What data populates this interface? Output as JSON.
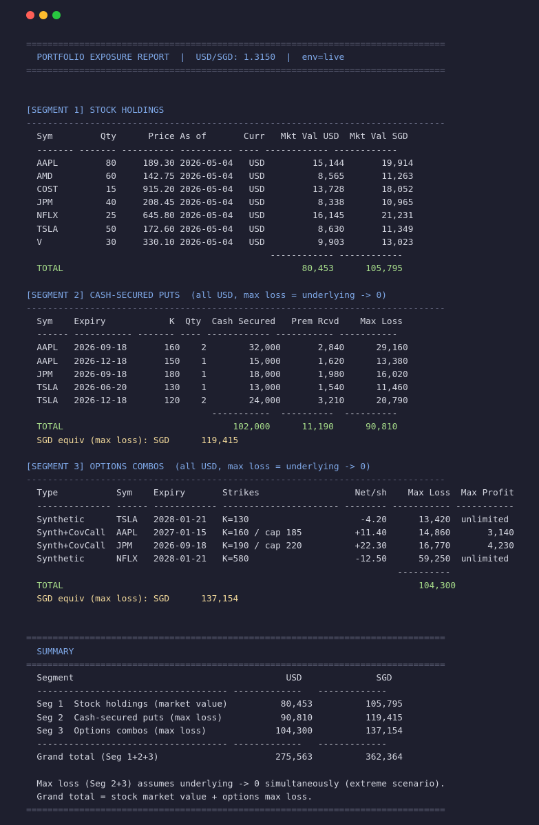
{
  "window": {
    "buttons": [
      "close",
      "minimize",
      "maximize"
    ]
  },
  "colors": {
    "background": "#1e1f2e",
    "text": "#d2d4de",
    "heading": "#7ea7e6",
    "total": "#a6db8a",
    "sgd_equiv": "#f1d89a",
    "rule": "#5d6077"
  },
  "lines": [
    {
      "kind": "rule",
      "text": "==============================================================================="
    },
    {
      "kind": "heading",
      "text": "  PORTFOLIO EXPOSURE REPORT  |  USD/SGD: 1.3150  |  env=live"
    },
    {
      "kind": "rule",
      "text": "==============================================================================="
    },
    {
      "kind": "blank",
      "text": ""
    },
    {
      "kind": "blank",
      "text": ""
    },
    {
      "kind": "heading",
      "text": "[SEGMENT 1] STOCK HOLDINGS"
    },
    {
      "kind": "rule",
      "text": "-------------------------------------------------------------------------------"
    },
    {
      "kind": "text",
      "text": "  Sym         Qty      Price As of       Curr   Mkt Val USD  Mkt Val SGD"
    },
    {
      "kind": "text",
      "text": "  ------- ------- ---------- ---------- ---- ------------ ------------"
    },
    {
      "kind": "text",
      "text": "  AAPL         80     189.30 2026-05-04   USD         15,144       19,914"
    },
    {
      "kind": "text",
      "text": "  AMD          60     142.75 2026-05-04   USD          8,565       11,263"
    },
    {
      "kind": "text",
      "text": "  COST         15     915.20 2026-05-04   USD         13,728       18,052"
    },
    {
      "kind": "text",
      "text": "  JPM          40     208.45 2026-05-04   USD          8,338       10,965"
    },
    {
      "kind": "text",
      "text": "  NFLX         25     645.80 2026-05-04   USD         16,145       21,231"
    },
    {
      "kind": "text",
      "text": "  TSLA         50     172.60 2026-05-04   USD          8,630       11,349"
    },
    {
      "kind": "text",
      "text": "  V            30     330.10 2026-05-04   USD          9,903       13,023"
    },
    {
      "kind": "text",
      "text": "                                              ------------ ------------"
    },
    {
      "kind": "total",
      "text": "  TOTAL                                             80,453      105,795"
    },
    {
      "kind": "blank",
      "text": ""
    },
    {
      "kind": "heading",
      "text": "[SEGMENT 2] CASH-SECURED PUTS  (all USD, max loss = underlying -> 0)"
    },
    {
      "kind": "rule",
      "text": "-------------------------------------------------------------------------------"
    },
    {
      "kind": "text",
      "text": "  Sym    Expiry            K  Qty  Cash Secured   Prem Rcvd    Max Loss"
    },
    {
      "kind": "text",
      "text": "  ------ ----------- ------- ---- ------------ ----------- -----------"
    },
    {
      "kind": "text",
      "text": "  AAPL   2026-09-18       160    2        32,000       2,840      29,160"
    },
    {
      "kind": "text",
      "text": "  AAPL   2026-12-18       150    1        15,000       1,620      13,380"
    },
    {
      "kind": "text",
      "text": "  JPM    2026-09-18       180    1        18,000       1,980      16,020"
    },
    {
      "kind": "text",
      "text": "  TSLA   2026-06-20       130    1        13,000       1,540      11,460"
    },
    {
      "kind": "text",
      "text": "  TSLA   2026-12-18       120    2        24,000       3,210      20,790"
    },
    {
      "kind": "text",
      "text": "                                   -----------  ----------  ----------"
    },
    {
      "kind": "total",
      "text": "  TOTAL                                102,000      11,190      90,810"
    },
    {
      "kind": "sgd",
      "text": "  SGD equiv (max loss): SGD      119,415"
    },
    {
      "kind": "blank",
      "text": ""
    },
    {
      "kind": "heading",
      "text": "[SEGMENT 3] OPTIONS COMBOS  (all USD, max loss = underlying -> 0)"
    },
    {
      "kind": "rule",
      "text": "-------------------------------------------------------------------------------"
    },
    {
      "kind": "text",
      "text": "  Type           Sym    Expiry       Strikes                  Net/sh    Max Loss  Max Profit"
    },
    {
      "kind": "text",
      "text": "  -------------- ------ ------------ ---------------------- -------- ----------- -----------"
    },
    {
      "kind": "text",
      "text": "  Synthetic      TSLA   2028-01-21   K=130                     -4.20      13,420  unlimited"
    },
    {
      "kind": "text",
      "text": "  Synth+CovCall  AAPL   2027-01-15   K=160 / cap 185          +11.40      14,860       3,140"
    },
    {
      "kind": "text",
      "text": "  Synth+CovCall  JPM    2026-09-18   K=190 / cap 220          +22.30      16,770       4,230"
    },
    {
      "kind": "text",
      "text": "  Synthetic      NFLX   2028-01-21   K=580                    -12.50      59,250  unlimited"
    },
    {
      "kind": "text",
      "text": "                                                                      ----------"
    },
    {
      "kind": "total",
      "text": "  TOTAL                                                                   104,300"
    },
    {
      "kind": "sgd",
      "text": "  SGD equiv (max loss): SGD      137,154"
    },
    {
      "kind": "blank",
      "text": ""
    },
    {
      "kind": "blank",
      "text": ""
    },
    {
      "kind": "rule",
      "text": "==============================================================================="
    },
    {
      "kind": "heading",
      "text": "  SUMMARY"
    },
    {
      "kind": "rule",
      "text": "==============================================================================="
    },
    {
      "kind": "text",
      "text": "  Segment                                        USD              SGD"
    },
    {
      "kind": "text",
      "text": "  ------------------------------------ -------------   -------------"
    },
    {
      "kind": "text",
      "text": "  Seg 1  Stock holdings (market value)          80,453          105,795"
    },
    {
      "kind": "text",
      "text": "  Seg 2  Cash-secured puts (max loss)           90,810          119,415"
    },
    {
      "kind": "text",
      "text": "  Seg 3  Options combos (max loss)             104,300          137,154"
    },
    {
      "kind": "text",
      "text": "  ------------------------------------ -------------   -------------"
    },
    {
      "kind": "text",
      "text": "  Grand total (Seg 1+2+3)                      275,563          362,364"
    },
    {
      "kind": "blank",
      "text": ""
    },
    {
      "kind": "text",
      "text": "  Max loss (Seg 2+3) assumes underlying -> 0 simultaneously (extreme scenario)."
    },
    {
      "kind": "text",
      "text": "  Grand total = stock market value + options max loss."
    },
    {
      "kind": "rule",
      "text": "==============================================================================="
    }
  ]
}
